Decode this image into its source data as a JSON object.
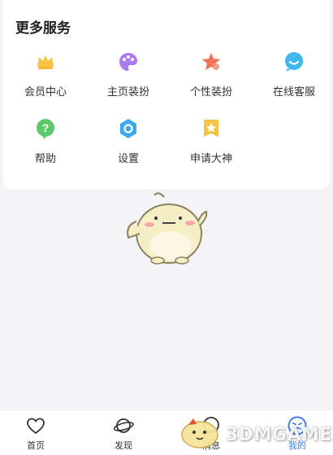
{
  "card": {
    "title": "更多服务"
  },
  "services": [
    {
      "label": "会员中心",
      "icon": "crown-icon",
      "color": "#f6c343"
    },
    {
      "label": "主页装扮",
      "icon": "palette-icon",
      "color": "#a97cf2"
    },
    {
      "label": "个性装扮",
      "icon": "star-badge-icon",
      "color": "#f0735a"
    },
    {
      "label": "在线客服",
      "icon": "chat-smile-icon",
      "color": "#3fb8f0"
    },
    {
      "label": "帮助",
      "icon": "help-icon",
      "color": "#5cc96d"
    },
    {
      "label": "设置",
      "icon": "settings-icon",
      "color": "#3fa9f0"
    },
    {
      "label": "申请大神",
      "icon": "ribbon-star-icon",
      "color": "#f6c343"
    }
  ],
  "tabbar": {
    "items": [
      {
        "label": "首页",
        "icon": "heart-icon"
      },
      {
        "label": "发现",
        "icon": "planet-icon"
      },
      {
        "label": "消息",
        "icon": "message-icon"
      },
      {
        "label": "我的",
        "icon": "profile-face-icon",
        "active": true
      }
    ]
  },
  "watermark": {
    "text": "3DMGAME"
  },
  "colors": {
    "accent": "#3d7bf7",
    "background": "#f4f4f6"
  }
}
